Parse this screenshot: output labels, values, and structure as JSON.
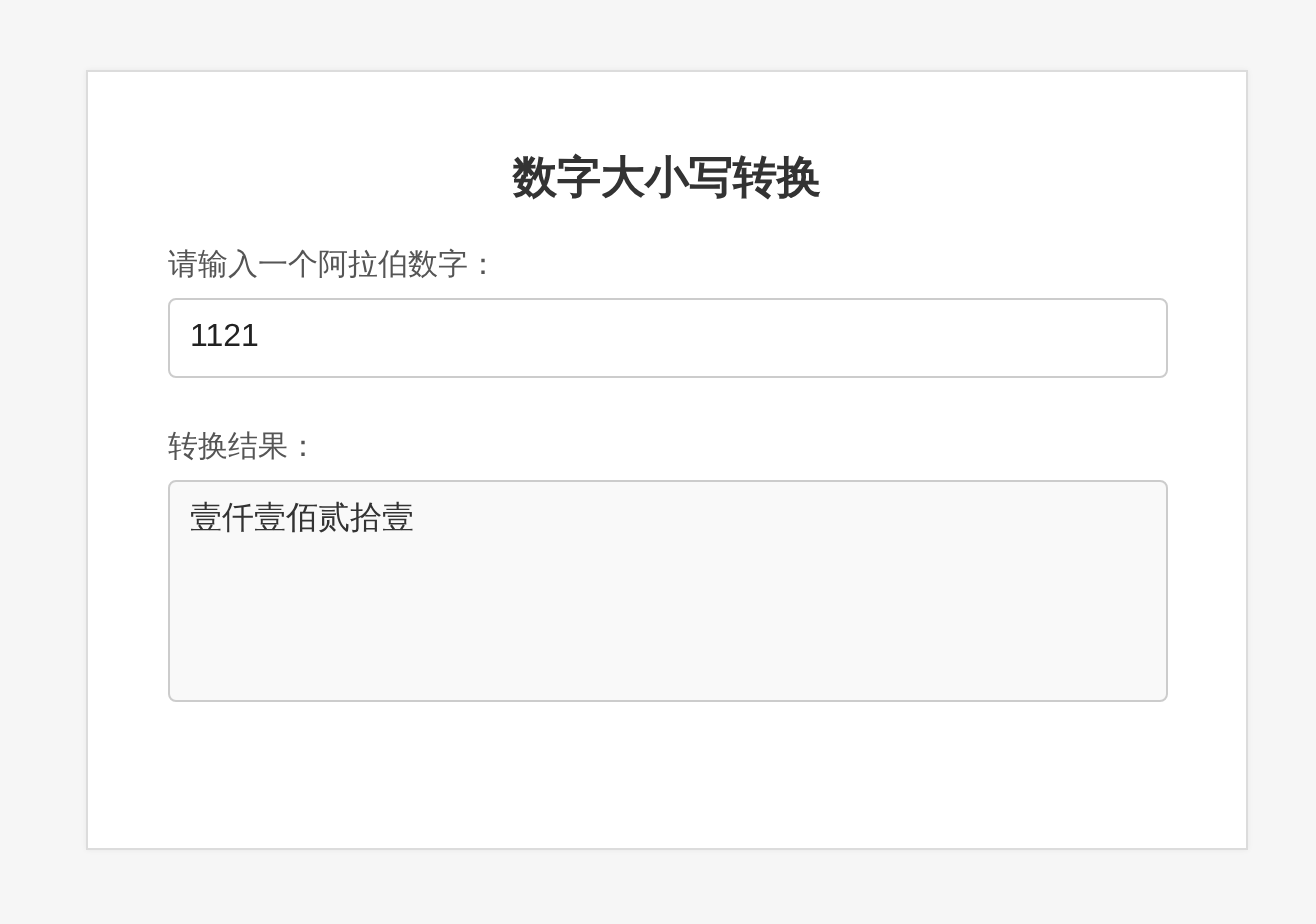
{
  "title": "数字大小写转换",
  "input": {
    "label": "请输入一个阿拉伯数字：",
    "value": "1121"
  },
  "result": {
    "label": "转换结果：",
    "value": "壹仟壹佰贰拾壹"
  }
}
